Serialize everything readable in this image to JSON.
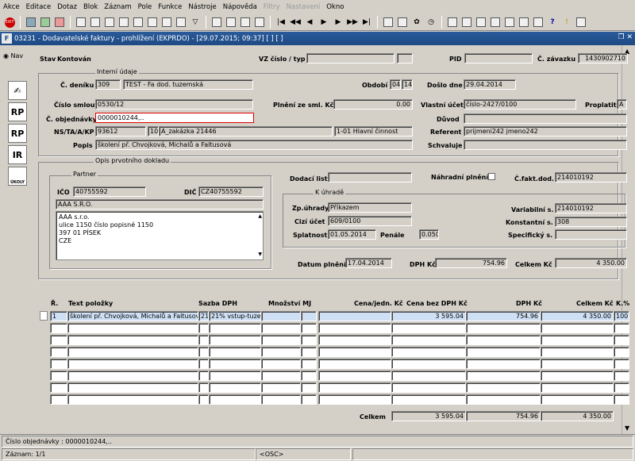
{
  "menu": [
    "Akce",
    "Editace",
    "Dotaz",
    "Blok",
    "Záznam",
    "Pole",
    "Funkce",
    "Nástroje",
    "Nápověda",
    "Filtry",
    "Nastavení",
    "Okno"
  ],
  "menu_disabled": [
    "Filtry",
    "Nastavení"
  ],
  "window": {
    "icon": "F",
    "title": "03231 - Dodavatelské faktury - prohlížení (EKPRDO) - [29.07.2015; 09:37] [ ] [ ]"
  },
  "nav_label": "Nav",
  "side_buttons": [
    "RP",
    "RP",
    "IR",
    "ÚKOLY"
  ],
  "header": {
    "stav_label": "Stav",
    "stav_value": "Kontován",
    "vz_label": "VZ číslo / typ",
    "vz_value": "",
    "vz_typ": "",
    "pid_label": "PID",
    "pid_value": "",
    "zavazku_label": "Č. závazku",
    "zavazku_value": "1430902710"
  },
  "interni": {
    "title": "Interní údaje",
    "cdeniku_label": "Č. deníku",
    "cdeniku_value": "309",
    "cdeniku_name": "TEST - Fa dod. tuzemská",
    "obdobi_label": "Období",
    "obdobi_m": "04",
    "obdobi_y": "14",
    "doslo_label": "Došlo dne",
    "doslo_value": "29.04.2014",
    "smlouvy_label": "Číslo smlouvy",
    "smlouvy_value": "0530/12",
    "plneni_label": "Plnění ze sml. Kč",
    "plneni_value": "0.00",
    "vlastni_label": "Vlastní účet",
    "vlastni_value": "číslo-2427/0100",
    "proplatit_label": "Proplatit",
    "proplatit_value": "A",
    "objednavky_label": "Č. objednávky",
    "objednavky_value": "0000010244,..",
    "duvod_label": "Důvod",
    "duvod_value": "",
    "ns_label": "NS/TA/A/KP",
    "ns1": "93612",
    "ns2": "10",
    "ns3": "A_zakázka 21446",
    "ns4": "1-01 Hlavní činnost",
    "referent_label": "Referent",
    "referent_value": "prijmeni242 jmeno242",
    "popis_label": "Popis",
    "popis_value": "školení př. Chvojková, Michalů a Faltusová",
    "schvaluje_label": "Schvaluje",
    "schvaluje_value": ""
  },
  "prvotni": {
    "title": "Opis prvotního dokladu",
    "partner_title": "Partner",
    "ico_label": "IČO",
    "ico_value": "40755592",
    "dic_label": "DIČ",
    "dic_value": "CZ40755592",
    "nazev": "AAA S.R.O.",
    "adresa": [
      "AAA s.r.o.",
      "ulice 1150 číslo popisné 1150",
      "397 01 PÍSEK",
      "CZE"
    ],
    "dodaci_label": "Dodací list",
    "dodaci_value": "",
    "nahradni_label": "Náhradní plnění",
    "cfakt_label": "Č.fakt.dod.",
    "cfakt_value": "214010192"
  },
  "uhrade": {
    "title": "K úhradě",
    "zp_label": "Zp.úhrady",
    "zp_value": "Příkazem",
    "cizi_label": "Cizí účet",
    "cizi_value": "609/0100",
    "splatnost_label": "Splatnost",
    "splatnost_value": "01.05.2014",
    "penale_label": "Penále",
    "penale_value": "0.050",
    "var_label": "Variabilní s.",
    "var_value": "214010192",
    "konst_label": "Konstantní s.",
    "konst_value": "308",
    "spec_label": "Specifický s.",
    "spec_value": ""
  },
  "sumy": {
    "datum_label": "Datum plnění",
    "datum_value": "17.04.2014",
    "dph_label": "DPH Kč",
    "dph_value": "754.96",
    "celkem_label": "Celkem Kč",
    "celkem_value": "4 350.00"
  },
  "grid": {
    "headers": [
      "Ř.",
      "Text položky",
      "Sazba DPH",
      "Množství MJ",
      "Cena/jedn. Kč",
      "Cena bez DPH Kč",
      "DPH Kč",
      "Celkem Kč",
      "K.%"
    ],
    "row": {
      "r": "1",
      "text": "školení př. Chvojková, Michalů a Faltusová",
      "sazba_c": "21",
      "sazba": "21% vstup-tuze",
      "mnozstvi": "",
      "mj": "",
      "cena": "",
      "bez_dph": "3 595.04",
      "dph": "754.96",
      "celkem": "4 350.00",
      "k": "100"
    }
  },
  "totals": {
    "label": "Celkem",
    "bez_dph": "3 595.04",
    "dph": "754.96",
    "celkem": "4 350.00"
  },
  "status": {
    "hint": "Číslo objednávky : 0000010244,..",
    "record": "Záznam: 1/1",
    "osc": "<OSC>"
  }
}
